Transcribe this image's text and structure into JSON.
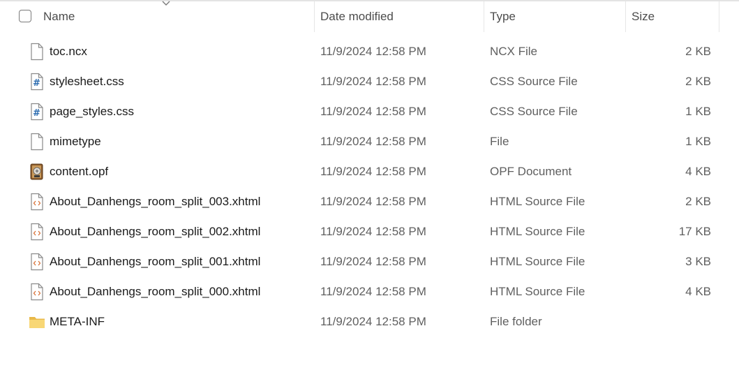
{
  "header": {
    "name": "Name",
    "date_modified": "Date modified",
    "type": "Type",
    "size": "Size"
  },
  "files": [
    {
      "name": "toc.ncx",
      "date": "11/9/2024 12:58 PM",
      "type": "NCX File",
      "size": "2 KB",
      "icon": "blank-file-icon"
    },
    {
      "name": "stylesheet.css",
      "date": "11/9/2024 12:58 PM",
      "type": "CSS Source File",
      "size": "2 KB",
      "icon": "css-file-icon"
    },
    {
      "name": "page_styles.css",
      "date": "11/9/2024 12:58 PM",
      "type": "CSS Source File",
      "size": "1 KB",
      "icon": "css-file-icon"
    },
    {
      "name": "mimetype",
      "date": "11/9/2024 12:58 PM",
      "type": "File",
      "size": "1 KB",
      "icon": "blank-file-icon"
    },
    {
      "name": "content.opf",
      "date": "11/9/2024 12:58 PM",
      "type": "OPF Document",
      "size": "4 KB",
      "icon": "opf-document-icon"
    },
    {
      "name": "About_Danhengs_room_split_003.xhtml",
      "date": "11/9/2024 12:58 PM",
      "type": "HTML Source File",
      "size": "2 KB",
      "icon": "html-file-icon"
    },
    {
      "name": "About_Danhengs_room_split_002.xhtml",
      "date": "11/9/2024 12:58 PM",
      "type": "HTML Source File",
      "size": "17 KB",
      "icon": "html-file-icon"
    },
    {
      "name": "About_Danhengs_room_split_001.xhtml",
      "date": "11/9/2024 12:58 PM",
      "type": "HTML Source File",
      "size": "3 KB",
      "icon": "html-file-icon"
    },
    {
      "name": "About_Danhengs_room_split_000.xhtml",
      "date": "11/9/2024 12:58 PM",
      "type": "HTML Source File",
      "size": "4 KB",
      "icon": "html-file-icon"
    },
    {
      "name": "META-INF",
      "date": "11/9/2024 12:58 PM",
      "type": "File folder",
      "size": "",
      "icon": "folder-icon"
    }
  ],
  "colors": {
    "folder": "#f8d775",
    "folder_dark": "#e9b949",
    "css_hash": "#2b6cb0",
    "html_tag": "#d9733a",
    "page_outline": "#8a8a8a"
  }
}
